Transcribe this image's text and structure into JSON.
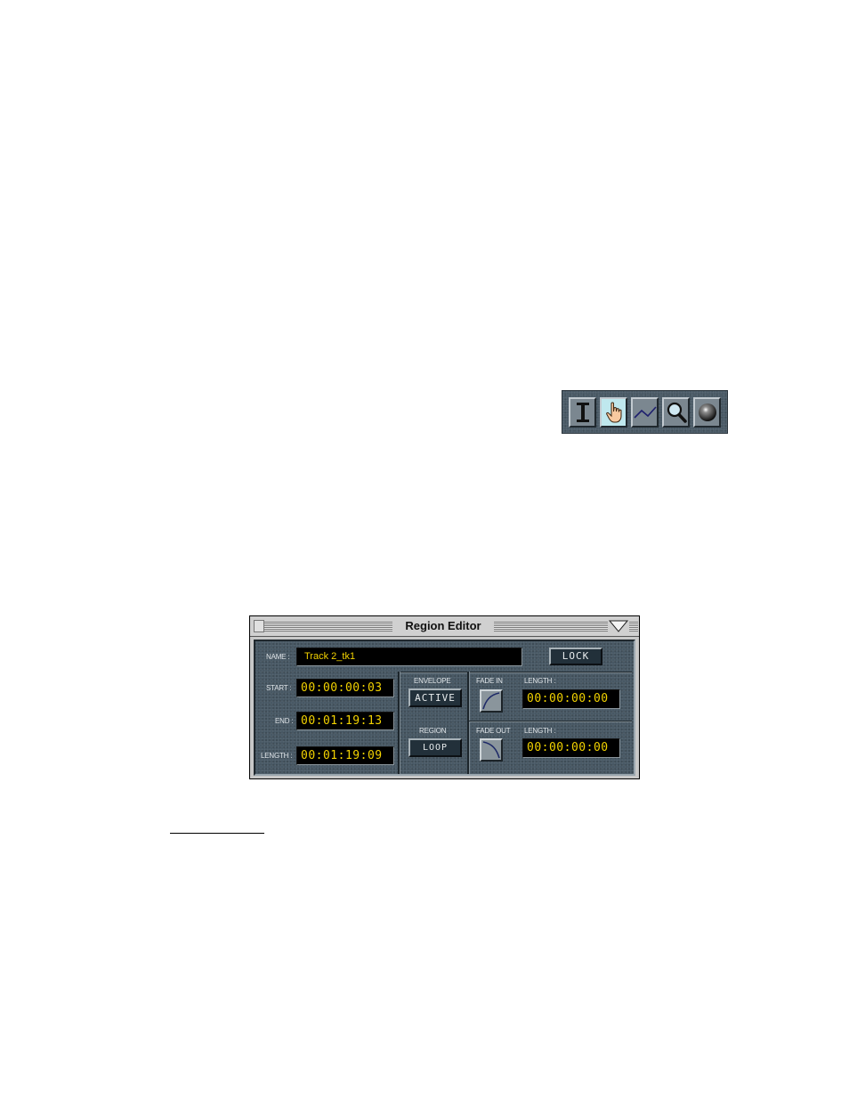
{
  "toolbar": {
    "tools": [
      {
        "icon": "text-cursor-icon",
        "selected": false
      },
      {
        "icon": "hand-pointer-icon",
        "selected": true
      },
      {
        "icon": "envelope-line-icon",
        "selected": false
      },
      {
        "icon": "magnifier-icon",
        "selected": false
      },
      {
        "icon": "sphere-icon",
        "selected": false
      }
    ]
  },
  "region_editor": {
    "title": "Region Editor",
    "name_label": "NAME :",
    "name_value": "Track 2_tk1",
    "lock_label": "LOCK",
    "start_label": "START :",
    "start_value": "00:00:00:03",
    "end_label": "END :",
    "end_value": "00:01:19:13",
    "length_label": "LENGTH :",
    "length_value": "00:01:19:09",
    "envelope_label": "ENVELOPE",
    "envelope_value": "ACTIVE",
    "region_label": "REGION",
    "region_value": "LOOP",
    "fade_in_label": "FADE IN",
    "fade_in_length_label": "LENGTH :",
    "fade_in_length_value": "00:00:00:00",
    "fade_out_label": "FADE OUT",
    "fade_out_length_label": "LENGTH :",
    "fade_out_length_value": "00:00:00:00"
  }
}
